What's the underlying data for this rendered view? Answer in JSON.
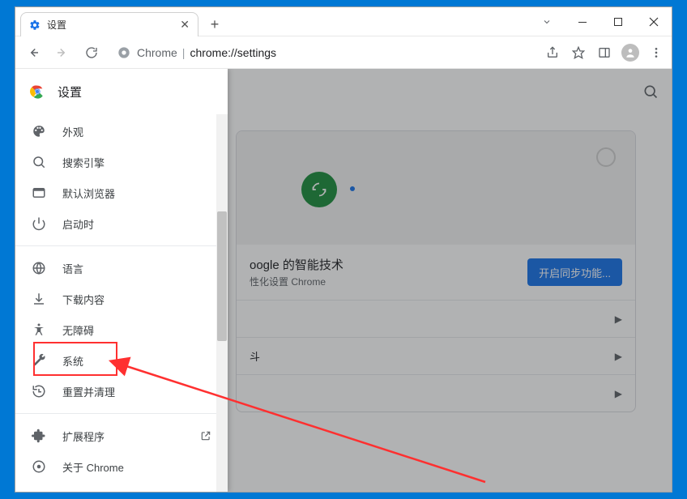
{
  "tab": {
    "title": "设置"
  },
  "address": {
    "prefix": "Chrome",
    "url": "chrome://settings"
  },
  "sidebar": {
    "title": "设置",
    "items": [
      {
        "icon": "palette",
        "label": "外观"
      },
      {
        "icon": "search",
        "label": "搜索引擎"
      },
      {
        "icon": "browser",
        "label": "默认浏览器"
      },
      {
        "icon": "power",
        "label": "启动时"
      },
      {
        "icon": "globe",
        "label": "语言"
      },
      {
        "icon": "download",
        "label": "下载内容"
      },
      {
        "icon": "accessibility",
        "label": "无障碍"
      },
      {
        "icon": "wrench",
        "label": "系统"
      },
      {
        "icon": "restore",
        "label": "重置并清理"
      },
      {
        "icon": "extension",
        "label": "扩展程序"
      },
      {
        "icon": "chrome",
        "label": "关于 Chrome"
      }
    ]
  },
  "main": {
    "sync_title_partial": "oogle 的智能技术",
    "sync_sub_partial": "性化设置 Chrome",
    "sync_button": "开启同步功能...",
    "row_partial": "斗"
  }
}
